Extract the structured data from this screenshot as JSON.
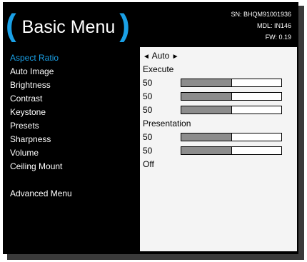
{
  "header": {
    "open_paren": "(",
    "title": "Basic Menu",
    "close_paren": ")",
    "serial": "SN: BHQM91001936",
    "model": "MDL: IN146",
    "firmware": "FW: 0.19"
  },
  "menu": {
    "items": [
      {
        "label": "Aspect Ratio"
      },
      {
        "label": "Auto Image"
      },
      {
        "label": "Brightness"
      },
      {
        "label": "Contrast"
      },
      {
        "label": "Keystone"
      },
      {
        "label": "Presets"
      },
      {
        "label": "Sharpness"
      },
      {
        "label": "Volume"
      },
      {
        "label": "Ceiling Mount"
      },
      {
        "label": "Advanced Menu"
      }
    ],
    "selected_index": 0
  },
  "values": {
    "aspect_ratio": {
      "left_arrow": "◄",
      "value": "Auto",
      "right_arrow": "►"
    },
    "auto_image": "Execute",
    "brightness": {
      "value": "50",
      "fill_fraction": 0.5
    },
    "contrast": {
      "value": "50",
      "fill_fraction": 0.5
    },
    "keystone": {
      "value": "50",
      "fill_fraction": 0.5
    },
    "presets": "Presentation",
    "sharpness": {
      "value": "50",
      "fill_fraction": 0.5
    },
    "volume": {
      "value": "50",
      "fill_fraction": 0.5
    },
    "ceiling_mount": "Off"
  },
  "colors": {
    "accent": "#1aa0e6",
    "panel": "#000000",
    "value_area": "#f4f4f4",
    "bar_fill": "#8c8c8c"
  }
}
